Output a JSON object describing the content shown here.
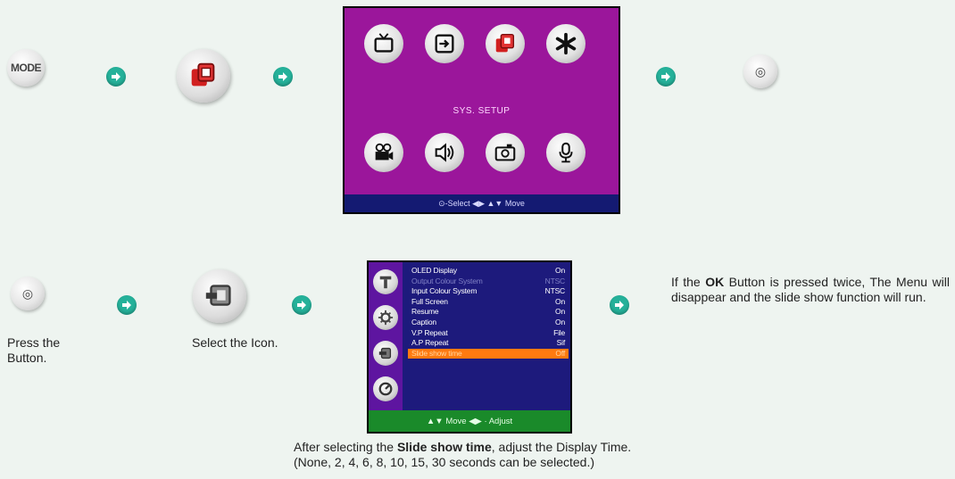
{
  "step1": {
    "mode_button_label": "MODE",
    "icon_name": "sys-setup-icon"
  },
  "menu_screen": {
    "label": "SYS. SETUP",
    "footer": "⊙-Select ◀▶ ▲▼ Move",
    "icons": [
      "tv-icon",
      "input-icon",
      "sys-setup-icon",
      "star-icon",
      "video-camera-icon",
      "speaker-icon",
      "camera-icon",
      "microphone-icon"
    ]
  },
  "ok_button_label": "◎",
  "step2": {
    "press_text": "Press the Button.",
    "select_text": "Select the Icon."
  },
  "setup_screen": {
    "rows": [
      {
        "label": "OLED Display",
        "value": "On",
        "state": "normal"
      },
      {
        "label": "Output Colour System",
        "value": "NTSC",
        "state": "dim"
      },
      {
        "label": "Input Colour System",
        "value": "NTSC",
        "state": "normal"
      },
      {
        "label": "Full Screen",
        "value": "On",
        "state": "normal"
      },
      {
        "label": "Resume",
        "value": "On",
        "state": "normal"
      },
      {
        "label": "Caption",
        "value": "On",
        "state": "normal"
      },
      {
        "label": "V.P Repeat",
        "value": "File",
        "state": "normal"
      },
      {
        "label": "A.P Repeat",
        "value": "Sif",
        "state": "normal"
      },
      {
        "label": "Slide show time",
        "value": "Off",
        "state": "selected"
      }
    ],
    "footer": "▲▼ Move ◀▶ · Adjust"
  },
  "instruction_right": {
    "prefix": "If the ",
    "bold": "OK",
    "suffix": " Button is pressed twice, The Menu will disappear and the slide show function will run."
  },
  "instruction_bottom": {
    "line1_prefix": "After selecting the ",
    "line1_bold": "Slide show time",
    "line1_suffix": ", adjust the Display Time.",
    "line2": "(None, 2, 4, 6, 8, 10, 15, 30 seconds can be selected.)"
  }
}
